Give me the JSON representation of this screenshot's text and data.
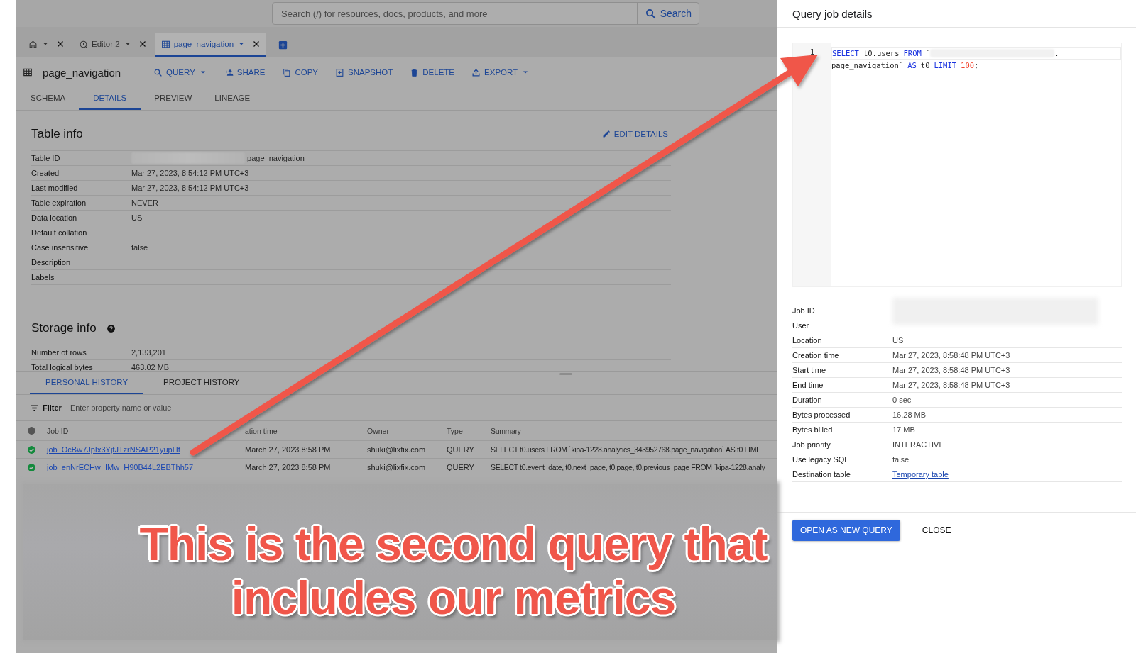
{
  "search": {
    "placeholder": "Search (/) for resources, docs, products, and more",
    "button": "Search"
  },
  "editor_tabs": [
    {
      "kind": "home",
      "selected": false
    },
    {
      "kind": "query",
      "label": "Editor 2",
      "selected": false
    },
    {
      "kind": "table",
      "label": "page_navigation",
      "selected": true
    }
  ],
  "table_header": {
    "title": "page_navigation",
    "actions": [
      {
        "kind": "query",
        "label": "QUERY",
        "dropdown": true
      },
      {
        "kind": "share",
        "label": "SHARE",
        "dropdown": false
      },
      {
        "kind": "copy",
        "label": "COPY",
        "dropdown": false
      },
      {
        "kind": "snapshot",
        "label": "SNAPSHOT",
        "dropdown": false
      },
      {
        "kind": "delete",
        "label": "DELETE",
        "dropdown": false
      },
      {
        "kind": "export",
        "label": "EXPORT",
        "dropdown": true
      }
    ]
  },
  "detail_tabs": [
    {
      "label": "SCHEMA",
      "selected": false
    },
    {
      "label": "DETAILS",
      "selected": true
    },
    {
      "label": "PREVIEW",
      "selected": false
    },
    {
      "label": "LINEAGE",
      "selected": false
    }
  ],
  "table_info": {
    "title": "Table info",
    "edit": "EDIT DETAILS",
    "rows": [
      {
        "label": "Table ID",
        "value": ".page_navigation",
        "redacted": true
      },
      {
        "label": "Created",
        "value": "Mar 27, 2023, 8:54:12 PM UTC+3",
        "redacted": false
      },
      {
        "label": "Last modified",
        "value": "Mar 27, 2023, 8:54:12 PM UTC+3",
        "redacted": false
      },
      {
        "label": "Table expiration",
        "value": "NEVER",
        "redacted": false
      },
      {
        "label": "Data location",
        "value": "US",
        "redacted": false
      },
      {
        "label": "Default collation",
        "redacted": false
      },
      {
        "label": "Case insensitive",
        "value": "false",
        "redacted": false
      },
      {
        "label": "Description",
        "redacted": false
      },
      {
        "label": "Labels",
        "redacted": false
      }
    ]
  },
  "storage_info": {
    "title": "Storage info",
    "rows": [
      {
        "label": "Number of rows",
        "value": "2,133,201"
      },
      {
        "label": "Total logical bytes",
        "value": "463.02 MB"
      }
    ]
  },
  "history": {
    "tabs": [
      {
        "label": "PERSONAL HISTORY",
        "selected": true
      },
      {
        "label": "PROJECT HISTORY",
        "selected": false
      }
    ],
    "filter": {
      "label": "Filter",
      "placeholder": "Enter property name or value"
    },
    "columns": [
      "Job ID",
      "ation time",
      "Owner",
      "Type",
      "Summary"
    ],
    "rows": [
      {
        "kind": "success",
        "job_id": "job_OcBw7JpIx3YjfJTzrNSAP21yupHf",
        "time": "March 27, 2023 8:58 PM",
        "owner": "shuki@lixfix.com",
        "type": "QUERY",
        "summary": "SELECT t0.users FROM `kipa-1228.analytics_343952768.page_navigation` AS t0 LIMI"
      },
      {
        "kind": "success",
        "job_id": "job_enNrECHw_IMw_H90B44L2EBThh57",
        "time": "March 27, 2023 8:58 PM",
        "owner": "shuki@lixfix.com",
        "type": "QUERY",
        "summary": "SELECT t0.event_date, t0.next_page, t0.page, t0.previous_page FROM `kipa-1228.analy"
      }
    ]
  },
  "panel": {
    "title": "Query job details",
    "gutter": [
      "1"
    ],
    "code_lines": [
      [
        {
          "kind": "keyword",
          "text": "SELECT"
        },
        {
          "kind": "plain",
          "text": "t0.users"
        },
        {
          "kind": "keyword",
          "text": "FROM"
        },
        {
          "kind": "plain",
          "text": "`"
        },
        {
          "kind": "redacted"
        },
        {
          "kind": "punct",
          "text": "."
        }
      ],
      [
        {
          "kind": "plain",
          "text": "page_navigation`"
        },
        {
          "kind": "keyword",
          "text": "AS"
        },
        {
          "kind": "plain",
          "text": "t0"
        },
        {
          "kind": "keyword",
          "text": "LIMIT"
        },
        {
          "kind": "number",
          "text": "100"
        },
        {
          "kind": "punct",
          "text": ";"
        }
      ]
    ],
    "details": [
      {
        "label": "Job ID",
        "kind": "redacted"
      },
      {
        "label": "User",
        "kind": "redacted"
      },
      {
        "label": "Location",
        "kind": "text",
        "value": "US"
      },
      {
        "label": "Creation time",
        "kind": "text",
        "value": "Mar 27, 2023, 8:58:48 PM UTC+3"
      },
      {
        "label": "Start time",
        "kind": "text",
        "value": "Mar 27, 2023, 8:58:48 PM UTC+3"
      },
      {
        "label": "End time",
        "kind": "text",
        "value": "Mar 27, 2023, 8:58:48 PM UTC+3"
      },
      {
        "label": "Duration",
        "kind": "text",
        "value": "0 sec"
      },
      {
        "label": "Bytes processed",
        "kind": "text",
        "value": "16.28 MB"
      },
      {
        "label": "Bytes billed",
        "kind": "text",
        "value": "17 MB"
      },
      {
        "label": "Job priority",
        "kind": "text",
        "value": "INTERACTIVE"
      },
      {
        "label": "Use legacy SQL",
        "kind": "text",
        "value": "false"
      },
      {
        "label": "Destination table",
        "kind": "link",
        "value": "Temporary table"
      }
    ],
    "buttons": [
      {
        "kind": "primary",
        "label": "OPEN AS NEW QUERY"
      },
      {
        "kind": "text",
        "label": "CLOSE"
      }
    ]
  },
  "annotation": {
    "text": "This is the second query that includes our metrics"
  }
}
